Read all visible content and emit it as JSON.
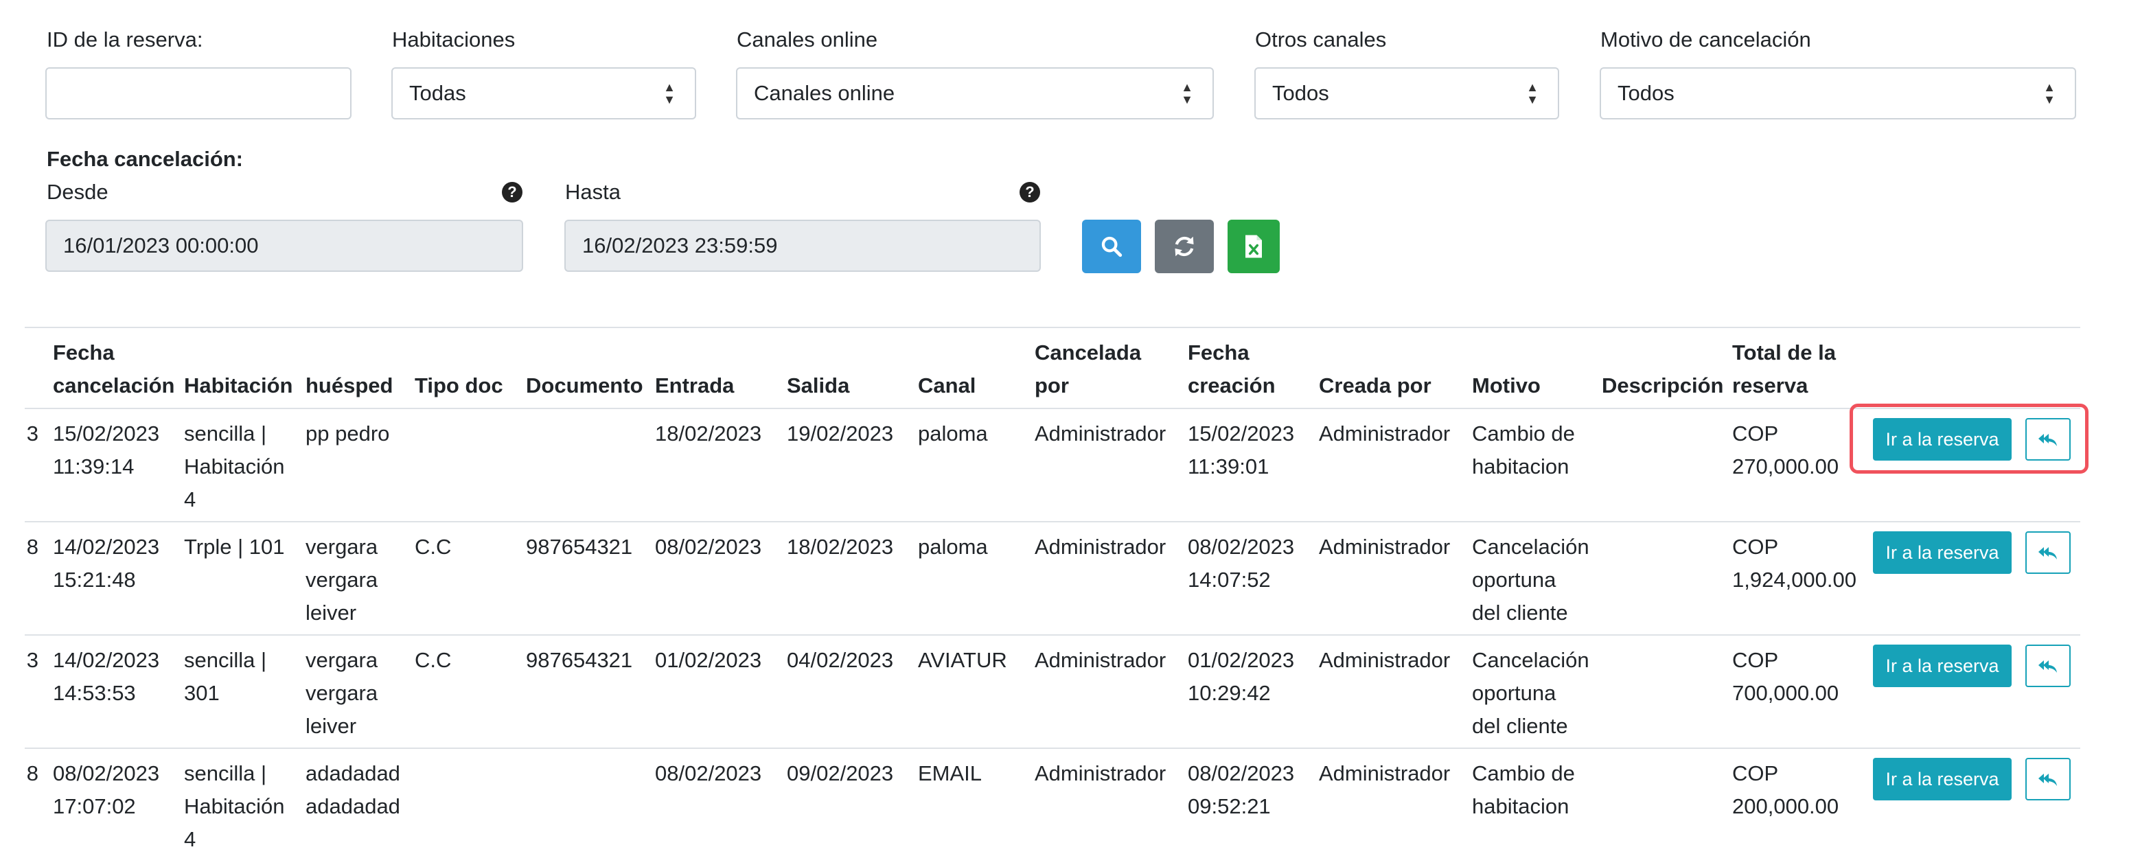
{
  "filters": {
    "reserva_id": {
      "label": "ID de la reserva:",
      "value": ""
    },
    "habitaciones": {
      "label": "Habitaciones",
      "value": "Todas"
    },
    "canales_online": {
      "label": "Canales online",
      "value": "Canales online"
    },
    "otros_canales": {
      "label": "Otros canales",
      "value": "Todos"
    },
    "motivo": {
      "label": "Motivo de cancelación",
      "value": "Todos"
    }
  },
  "fecha_cancelacion": {
    "title": "Fecha cancelación:",
    "desde_label": "Desde",
    "desde_value": "16/01/2023 00:00:00",
    "hasta_label": "Hasta",
    "hasta_value": "16/02/2023 23:59:59",
    "help_glyph": "?"
  },
  "colors": {
    "search": "#3498db",
    "refresh": "#6c757d",
    "excel": "#28a745",
    "accent": "#17a2b8",
    "highlight": "#f0525c"
  },
  "icons": [
    "search-icon",
    "refresh-icon",
    "excel-icon",
    "reply-icon",
    "help-icon",
    "select-caret-icon"
  ],
  "table": {
    "headers": {
      "fecha_cancelacion": [
        "Fecha",
        "cancelación"
      ],
      "habitacion": [
        "Habitación"
      ],
      "huesped": [
        "huésped"
      ],
      "tipo_doc": [
        "Tipo doc"
      ],
      "documento": [
        "Documento"
      ],
      "entrada": [
        "Entrada"
      ],
      "salida": [
        "Salida"
      ],
      "canal": [
        "Canal"
      ],
      "cancelada_por": [
        "Cancelada",
        "por"
      ],
      "fecha_creacion": [
        "Fecha",
        "creación"
      ],
      "creada_por": [
        "Creada por"
      ],
      "motivo": [
        "Motivo"
      ],
      "descripcion": [
        "Descripción"
      ],
      "total": [
        "Total de la",
        "reserva"
      ]
    },
    "go_label": "Ir a la reserva",
    "rows": [
      {
        "id_cut": "3",
        "fecha_cancelacion": [
          "15/02/2023",
          "11:39:14"
        ],
        "habitacion": [
          "sencilla |",
          "Habitación",
          "4"
        ],
        "huesped": [
          "pp pedro"
        ],
        "tipo_doc": [
          ""
        ],
        "documento": [
          ""
        ],
        "entrada": [
          "18/02/2023"
        ],
        "salida": [
          "19/02/2023"
        ],
        "canal": [
          "paloma"
        ],
        "cancelada_por": [
          "Administrador"
        ],
        "fecha_creacion": [
          "15/02/2023",
          "11:39:01"
        ],
        "creada_por": [
          "Administrador"
        ],
        "motivo": [
          "Cambio de",
          "habitacion"
        ],
        "descripcion": [
          ""
        ],
        "total": [
          "COP",
          "270,000.00"
        ]
      },
      {
        "id_cut": "8",
        "fecha_cancelacion": [
          "14/02/2023",
          "15:21:48"
        ],
        "habitacion": [
          "Trple | 101"
        ],
        "huesped": [
          "vergara",
          "vergara",
          "leiver"
        ],
        "tipo_doc": [
          "C.C"
        ],
        "documento": [
          "987654321"
        ],
        "entrada": [
          "08/02/2023"
        ],
        "salida": [
          "18/02/2023"
        ],
        "canal": [
          "paloma"
        ],
        "cancelada_por": [
          "Administrador"
        ],
        "fecha_creacion": [
          "08/02/2023",
          "14:07:52"
        ],
        "creada_por": [
          "Administrador"
        ],
        "motivo": [
          "Cancelación",
          "oportuna",
          "del cliente"
        ],
        "descripcion": [
          ""
        ],
        "total": [
          "COP",
          "1,924,000.00"
        ]
      },
      {
        "id_cut": "3",
        "fecha_cancelacion": [
          "14/02/2023",
          "14:53:53"
        ],
        "habitacion": [
          "sencilla |",
          "301"
        ],
        "huesped": [
          "vergara",
          "vergara",
          "leiver"
        ],
        "tipo_doc": [
          "C.C"
        ],
        "documento": [
          "987654321"
        ],
        "entrada": [
          "01/02/2023"
        ],
        "salida": [
          "04/02/2023"
        ],
        "canal": [
          "AVIATUR"
        ],
        "cancelada_por": [
          "Administrador"
        ],
        "fecha_creacion": [
          "01/02/2023",
          "10:29:42"
        ],
        "creada_por": [
          "Administrador"
        ],
        "motivo": [
          "Cancelación",
          "oportuna",
          "del cliente"
        ],
        "descripcion": [
          ""
        ],
        "total": [
          "COP",
          "700,000.00"
        ]
      },
      {
        "id_cut": "8",
        "fecha_cancelacion": [
          "08/02/2023",
          "17:07:02"
        ],
        "habitacion": [
          "sencilla |",
          "Habitación",
          "4"
        ],
        "huesped": [
          "adadadad",
          "adadadad"
        ],
        "tipo_doc": [
          ""
        ],
        "documento": [
          ""
        ],
        "entrada": [
          "08/02/2023"
        ],
        "salida": [
          "09/02/2023"
        ],
        "canal": [
          "EMAIL"
        ],
        "cancelada_por": [
          "Administrador"
        ],
        "fecha_creacion": [
          "08/02/2023",
          "09:52:21"
        ],
        "creada_por": [
          "Administrador"
        ],
        "motivo": [
          "Cambio de",
          "habitacion"
        ],
        "descripcion": [
          ""
        ],
        "total": [
          "COP",
          "200,000.00"
        ]
      }
    ]
  }
}
